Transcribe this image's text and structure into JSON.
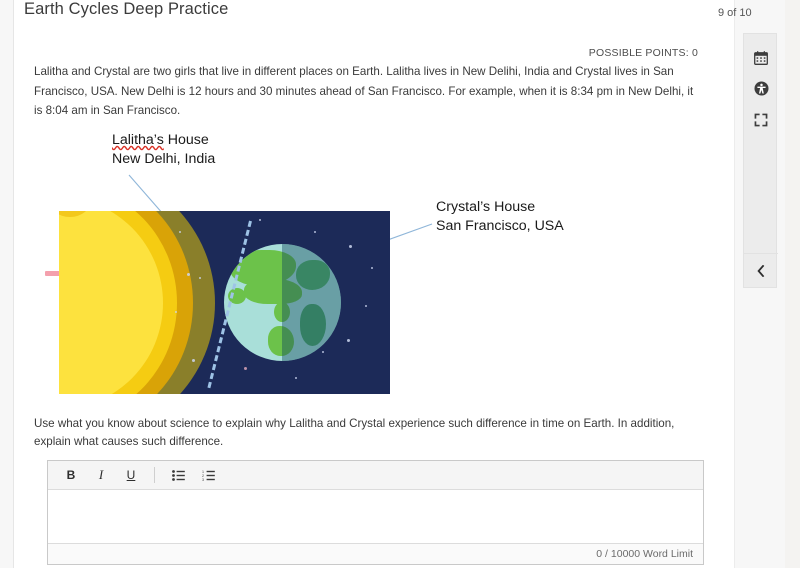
{
  "header": {
    "title": "Earth Cycles Deep Practice",
    "pagination": "9 of 10",
    "possible_points": "POSSIBLE POINTS: 0"
  },
  "prompt": {
    "paragraph_part1": "Lalitha and Crystal are two girls that live in different places on Earth. Lalitha lives in New Delihi, India and Crystal lives in San Francisco, USA. New Delhi is 12 hours and 30 minutes ahead of San Francisco. For example, when it is 8:34 pm in New Delhi, it is 8:04 am in San Francisco.",
    "instructions": "Use what you know about science to explain why Lalitha and Crystal experience such difference in time on Earth. In addition, explain what causes such difference."
  },
  "illustration": {
    "label_lalitha_name": "Lalitha’s",
    "label_lalitha_rest": " House",
    "label_lalitha_line2": "New Delhi, India",
    "label_crystal_line1": "Crystal’s House",
    "label_crystal_line2": "San Francisco, USA",
    "colors": {
      "space": "#1c2a58",
      "sun_core": "#fde23e",
      "sun_mid": "#f5cc12",
      "sun_outer": "#d9a307",
      "sun_rim": "#8a7f2a",
      "earth_ocean": "#a9dfd9",
      "earth_land": "#6cc24a",
      "axis": "#9ec3e6",
      "leader_line": "#8fb6d9",
      "pink_marker": "#f4a0ad"
    }
  },
  "editor": {
    "tools": [
      {
        "name": "bold",
        "label": "B"
      },
      {
        "name": "italic",
        "label": "I"
      },
      {
        "name": "underline",
        "label": "U"
      },
      {
        "name": "bulleted-list",
        "label": ""
      },
      {
        "name": "numbered-list",
        "label": ""
      }
    ],
    "bold_label": "B",
    "italic_label": "I",
    "underline_label": "U",
    "content": "",
    "word_limit_status": "0 / 10000 Word Limit"
  },
  "side_toolbar": {
    "buttons": [
      {
        "name": "calendar-icon",
        "title": "Calendar"
      },
      {
        "name": "accessibility-icon",
        "title": "Accessibility"
      },
      {
        "name": "fullscreen-icon",
        "title": "Fullscreen"
      }
    ],
    "collapse": {
      "name": "chevron-left-icon",
      "title": "Collapse"
    }
  }
}
